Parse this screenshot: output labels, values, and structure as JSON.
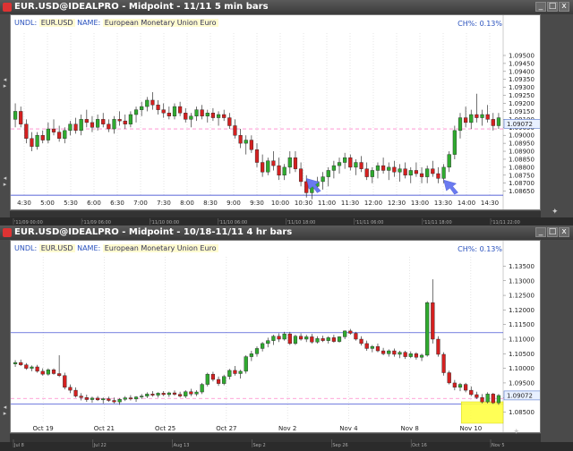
{
  "colors": {
    "bull": "#2faa2f",
    "bear": "#d42020",
    "grid": "#cccccc",
    "hline": "#2233cc",
    "pink": "#ff88cc",
    "highlight": "#ffff44",
    "arrow": "#6a7af0"
  },
  "panels": [
    {
      "title": "EUR.USD@IDEALPRO - Midpoint - 11/11 5 min bars",
      "info": {
        "prefix": "UNDL:",
        "symbol": "EUR.USD",
        "name_label": "NAME:",
        "name": "European Monetary Union Euro"
      },
      "change": "CH%: 0.13%",
      "price_label": "1.09072",
      "date_strip": [
        "'11/09 00:00",
        "'11/09 06:00",
        "'11/10 00:00",
        "'11/10 06:00",
        "'11/10 18:00",
        "'11/11 06:00",
        "'11/11 18:00",
        "'11/11 22:00"
      ],
      "buttons": {
        "min": "_",
        "max": "□",
        "close": "x"
      }
    },
    {
      "title": "EUR.USD@IDEALPRO - Midpoint - 10/18-11/11 4 hr bars",
      "info": {
        "prefix": "UNDL:",
        "symbol": "EUR.USD",
        "name_label": "NAME:",
        "name": "European Monetary Union Euro"
      },
      "change": "CH%: 0.13%",
      "price_label": "1.09072",
      "date_strip": [
        "Jul 8",
        "Jul 22",
        "Aug 13",
        "Sep 2",
        "Sep 26",
        "Oct 16",
        "Nov 5"
      ],
      "buttons": {
        "min": "_",
        "max": "□",
        "close": "x"
      }
    }
  ],
  "chart_data": [
    {
      "type": "candlestick",
      "title": "EUR.USD@IDEALPRO - Midpoint - 11/11 5 min bars",
      "x_ticks": [
        "4:30",
        "5:00",
        "5:30",
        "6:00",
        "6:30",
        "7:00",
        "7:30",
        "8:00",
        "8:30",
        "9:00",
        "9:30",
        "10:00",
        "10:30",
        "11:00",
        "11:30",
        "12:00",
        "12:30",
        "13:00",
        "13:30",
        "14:00",
        "14:30"
      ],
      "y_ticks": [
        1.0865,
        1.087,
        1.0875,
        1.088,
        1.0885,
        1.089,
        1.0895,
        1.09,
        1.0905,
        1.091,
        1.0915,
        1.092,
        1.0925,
        1.093,
        1.0935,
        1.094,
        1.0945,
        1.095
      ],
      "ylim": [
        1.0862,
        1.0964
      ],
      "reference_lines": [
        {
          "value": 1.08625,
          "style": "solid"
        },
        {
          "value": 1.0904,
          "style": "dashed"
        }
      ],
      "last_price": 1.09072,
      "candles": [
        [
          1.091,
          1.092,
          1.0905,
          1.0915
        ],
        [
          1.0915,
          1.0918,
          1.0905,
          1.0907
        ],
        [
          1.0907,
          1.091,
          1.0895,
          1.0898
        ],
        [
          1.0898,
          1.0902,
          1.089,
          1.0893
        ],
        [
          1.0893,
          1.0902,
          1.0891,
          1.09
        ],
        [
          1.09,
          1.0903,
          1.0895,
          1.0897
        ],
        [
          1.0897,
          1.0908,
          1.0895,
          1.0904
        ],
        [
          1.0904,
          1.091,
          1.09,
          1.0902
        ],
        [
          1.0902,
          1.0906,
          1.0896,
          1.0898
        ],
        [
          1.0898,
          1.0905,
          1.0895,
          1.0903
        ],
        [
          1.0903,
          1.0909,
          1.09,
          1.0907
        ],
        [
          1.0907,
          1.0911,
          1.0901,
          1.0903
        ],
        [
          1.0903,
          1.0913,
          1.09,
          1.091
        ],
        [
          1.091,
          1.0916,
          1.0905,
          1.0908
        ],
        [
          1.0908,
          1.0912,
          1.0902,
          1.0905
        ],
        [
          1.0905,
          1.0913,
          1.0903,
          1.091
        ],
        [
          1.091,
          1.0914,
          1.0905,
          1.0907
        ],
        [
          1.0907,
          1.091,
          1.0902,
          1.0904
        ],
        [
          1.0904,
          1.0912,
          1.0901,
          1.091
        ],
        [
          1.091,
          1.0915,
          1.0906,
          1.0909
        ],
        [
          1.0909,
          1.0913,
          1.0904,
          1.0907
        ],
        [
          1.0907,
          1.0915,
          1.0905,
          1.0913
        ],
        [
          1.0913,
          1.0918,
          1.0908,
          1.0916
        ],
        [
          1.0916,
          1.0921,
          1.0912,
          1.0918
        ],
        [
          1.0918,
          1.0924,
          1.0915,
          1.0922
        ],
        [
          1.0922,
          1.0927,
          1.0916,
          1.0919
        ],
        [
          1.0919,
          1.0922,
          1.0913,
          1.0916
        ],
        [
          1.0916,
          1.092,
          1.0911,
          1.0914
        ],
        [
          1.0914,
          1.0918,
          1.091,
          1.0912
        ],
        [
          1.0912,
          1.092,
          1.091,
          1.0918
        ],
        [
          1.0918,
          1.0921,
          1.0912,
          1.0914
        ],
        [
          1.0914,
          1.0917,
          1.0908,
          1.091
        ],
        [
          1.091,
          1.0914,
          1.0905,
          1.0912
        ],
        [
          1.0912,
          1.0918,
          1.0909,
          1.0916
        ],
        [
          1.0916,
          1.0919,
          1.091,
          1.0912
        ],
        [
          1.0912,
          1.0916,
          1.0908,
          1.0914
        ],
        [
          1.0914,
          1.0917,
          1.0909,
          1.0911
        ],
        [
          1.0911,
          1.0915,
          1.0906,
          1.0913
        ],
        [
          1.0913,
          1.0916,
          1.0909,
          1.0911
        ],
        [
          1.0911,
          1.0914,
          1.0904,
          1.0906
        ],
        [
          1.0906,
          1.091,
          1.0898,
          1.09
        ],
        [
          1.09,
          1.0904,
          1.0892,
          1.0895
        ],
        [
          1.0895,
          1.09,
          1.0888,
          1.0897
        ],
        [
          1.0897,
          1.09,
          1.0889,
          1.0891
        ],
        [
          1.0891,
          1.0895,
          1.088,
          1.0883
        ],
        [
          1.0883,
          1.0888,
          1.0874,
          1.0877
        ],
        [
          1.0877,
          1.0886,
          1.0875,
          1.0884
        ],
        [
          1.0884,
          1.089,
          1.0878,
          1.0881
        ],
        [
          1.0881,
          1.0886,
          1.0872,
          1.0875
        ],
        [
          1.0875,
          1.0882,
          1.0872,
          1.088
        ],
        [
          1.088,
          1.089,
          1.0876,
          1.0886
        ],
        [
          1.0886,
          1.089,
          1.0877,
          1.0879
        ],
        [
          1.0879,
          1.0883,
          1.0868,
          1.0871
        ],
        [
          1.0871,
          1.0875,
          1.0861,
          1.0864
        ],
        [
          1.0864,
          1.087,
          1.086,
          1.0868
        ],
        [
          1.0868,
          1.0874,
          1.0864,
          1.0871
        ],
        [
          1.0871,
          1.0877,
          1.0866,
          1.0874
        ],
        [
          1.0874,
          1.088,
          1.0868,
          1.0878
        ],
        [
          1.0878,
          1.0884,
          1.0873,
          1.0881
        ],
        [
          1.0881,
          1.0886,
          1.0876,
          1.0883
        ],
        [
          1.0883,
          1.0889,
          1.0879,
          1.0886
        ],
        [
          1.0886,
          1.0888,
          1.0878,
          1.088
        ],
        [
          1.088,
          1.0885,
          1.0875,
          1.0883
        ],
        [
          1.0883,
          1.0887,
          1.0877,
          1.0879
        ],
        [
          1.0879,
          1.0883,
          1.0872,
          1.0874
        ],
        [
          1.0874,
          1.088,
          1.087,
          1.0878
        ],
        [
          1.0878,
          1.0883,
          1.0873,
          1.0881
        ],
        [
          1.0881,
          1.0886,
          1.0876,
          1.0878
        ],
        [
          1.0878,
          1.0883,
          1.0872,
          1.088
        ],
        [
          1.088,
          1.0884,
          1.0874,
          1.0877
        ],
        [
          1.0877,
          1.0882,
          1.0871,
          1.0879
        ],
        [
          1.0879,
          1.0883,
          1.0873,
          1.0875
        ],
        [
          1.0875,
          1.088,
          1.087,
          1.0878
        ],
        [
          1.0878,
          1.0883,
          1.0874,
          1.0876
        ],
        [
          1.0876,
          1.088,
          1.087,
          1.0874
        ],
        [
          1.0874,
          1.0881,
          1.087,
          1.0879
        ],
        [
          1.0879,
          1.0884,
          1.0874,
          1.0876
        ],
        [
          1.0876,
          1.088,
          1.087,
          1.0873
        ],
        [
          1.0873,
          1.0882,
          1.087,
          1.088
        ],
        [
          1.088,
          1.089,
          1.0877,
          1.0888
        ],
        [
          1.0888,
          1.0906,
          1.0885,
          1.0903
        ],
        [
          1.0903,
          1.0914,
          1.0898,
          1.0911
        ],
        [
          1.0911,
          1.0918,
          1.0905,
          1.0908
        ],
        [
          1.0908,
          1.0916,
          1.0904,
          1.0913
        ],
        [
          1.0913,
          1.0926,
          1.0908,
          1.0911
        ],
        [
          1.0911,
          1.0916,
          1.0906,
          1.0913
        ],
        [
          1.0913,
          1.0919,
          1.0908,
          1.091
        ],
        [
          1.091,
          1.0914,
          1.0903,
          1.0906
        ],
        [
          1.0906,
          1.0914,
          1.0904,
          1.0911
        ]
      ],
      "annotations": [
        {
          "type": "arrow",
          "at_index": 53,
          "value": 1.0873
        },
        {
          "type": "arrow",
          "at_index": 78,
          "value": 1.0872
        }
      ]
    },
    {
      "type": "candlestick",
      "title": "EUR.USD@IDEALPRO - Midpoint - 10/18-11/11 4 hr bars",
      "x_ticks": [
        "Oct 19",
        "Oct 21",
        "Oct 25",
        "Oct 27",
        "Nov 2",
        "Nov 4",
        "Nov 8",
        "Nov 10"
      ],
      "y_ticks": [
        1.085,
        1.09,
        1.095,
        1.1,
        1.105,
        1.11,
        1.115,
        1.12,
        1.125,
        1.13,
        1.135
      ],
      "ylim": [
        1.0818,
        1.1382
      ],
      "reference_lines": [
        {
          "value": 1.1122,
          "style": "solid"
        },
        {
          "value": 1.0878,
          "style": "solid"
        },
        {
          "value": 1.0897,
          "style": "dashed"
        }
      ],
      "last_price": 1.09072,
      "candles": [
        [
          1.1015,
          1.1028,
          1.1005,
          1.102
        ],
        [
          1.102,
          1.103,
          1.1008,
          1.1012
        ],
        [
          1.1012,
          1.1018,
          1.0995,
          1.1
        ],
        [
          1.1,
          1.101,
          1.099,
          1.1005
        ],
        [
          1.1005,
          1.1012,
          1.0985,
          1.099
        ],
        [
          1.099,
          1.1,
          1.0975,
          1.098
        ],
        [
          1.098,
          1.1,
          1.0975,
          1.0995
        ],
        [
          1.0995,
          1.1,
          1.0978,
          1.0982
        ],
        [
          1.0982,
          1.1045,
          1.097,
          1.0975
        ],
        [
          1.0975,
          1.0985,
          1.0928,
          1.0935
        ],
        [
          1.0935,
          1.0945,
          1.0915,
          1.0925
        ],
        [
          1.0925,
          1.0935,
          1.09,
          1.0905
        ],
        [
          1.0905,
          1.0915,
          1.089,
          1.09
        ],
        [
          1.09,
          1.091,
          1.0885,
          1.0893
        ],
        [
          1.0893,
          1.0903,
          1.0882,
          1.0898
        ],
        [
          1.0898,
          1.0905,
          1.0888,
          1.0892
        ],
        [
          1.0892,
          1.09,
          1.088,
          1.0896
        ],
        [
          1.0896,
          1.0903,
          1.0885,
          1.089
        ],
        [
          1.089,
          1.09,
          1.088,
          1.0885
        ],
        [
          1.0885,
          1.0898,
          1.0875,
          1.0894
        ],
        [
          1.0894,
          1.0905,
          1.0888,
          1.0899
        ],
        [
          1.0899,
          1.0908,
          1.089,
          1.0895
        ],
        [
          1.0895,
          1.0905,
          1.0885,
          1.0902
        ],
        [
          1.0902,
          1.0912,
          1.0895,
          1.0905
        ],
        [
          1.0905,
          1.0918,
          1.0898,
          1.0912
        ],
        [
          1.0912,
          1.0922,
          1.0903,
          1.0908
        ],
        [
          1.0908,
          1.0918,
          1.09,
          1.0915
        ],
        [
          1.0915,
          1.0922,
          1.0905,
          1.091
        ],
        [
          1.091,
          1.092,
          1.0902,
          1.0916
        ],
        [
          1.0916,
          1.0924,
          1.0906,
          1.0911
        ],
        [
          1.0911,
          1.092,
          1.09,
          1.0905
        ],
        [
          1.0905,
          1.0925,
          1.0898,
          1.092
        ],
        [
          1.092,
          1.093,
          1.0905,
          1.0912
        ],
        [
          1.0912,
          1.0925,
          1.0905,
          1.0919
        ],
        [
          1.0919,
          1.095,
          1.0912,
          1.0945
        ],
        [
          1.0945,
          1.0985,
          1.0938,
          1.098
        ],
        [
          1.098,
          1.0988,
          1.0955,
          1.0962
        ],
        [
          1.0962,
          1.0972,
          1.094,
          1.0948
        ],
        [
          1.0948,
          1.0978,
          1.0942,
          1.0972
        ],
        [
          1.0972,
          1.0998,
          1.0962,
          1.0993
        ],
        [
          1.0993,
          1.1008,
          1.0975,
          1.0982
        ],
        [
          1.0982,
          1.0995,
          1.0965,
          1.099
        ],
        [
          1.099,
          1.1045,
          1.0982,
          1.104
        ],
        [
          1.104,
          1.106,
          1.1025,
          1.105
        ],
        [
          1.105,
          1.1075,
          1.104,
          1.1068
        ],
        [
          1.1068,
          1.109,
          1.1058,
          1.1085
        ],
        [
          1.1085,
          1.1105,
          1.1072,
          1.1095
        ],
        [
          1.1095,
          1.1115,
          1.108,
          1.111
        ],
        [
          1.111,
          1.112,
          1.109,
          1.11
        ],
        [
          1.11,
          1.1125,
          1.1095,
          1.1118
        ],
        [
          1.1118,
          1.1125,
          1.108,
          1.1085
        ],
        [
          1.1085,
          1.1115,
          1.108,
          1.111
        ],
        [
          1.111,
          1.112,
          1.1095,
          1.11
        ],
        [
          1.11,
          1.1115,
          1.109,
          1.1108
        ],
        [
          1.1108,
          1.1118,
          1.1085,
          1.109
        ],
        [
          1.109,
          1.111,
          1.1085,
          1.1102
        ],
        [
          1.1102,
          1.1112,
          1.109,
          1.1095
        ],
        [
          1.1095,
          1.111,
          1.1085,
          1.1105
        ],
        [
          1.1105,
          1.1115,
          1.1088,
          1.1092
        ],
        [
          1.1092,
          1.111,
          1.1088,
          1.1108
        ],
        [
          1.1108,
          1.113,
          1.11,
          1.1128
        ],
        [
          1.1128,
          1.1135,
          1.1115,
          1.112
        ],
        [
          1.112,
          1.1125,
          1.1095,
          1.11
        ],
        [
          1.11,
          1.111,
          1.1078,
          1.1085
        ],
        [
          1.1085,
          1.1095,
          1.106,
          1.1068
        ],
        [
          1.1068,
          1.108,
          1.1055,
          1.1075
        ],
        [
          1.1075,
          1.1085,
          1.1055,
          1.106
        ],
        [
          1.106,
          1.107,
          1.1045,
          1.105
        ],
        [
          1.105,
          1.1065,
          1.104,
          1.106
        ],
        [
          1.106,
          1.1068,
          1.104,
          1.1048
        ],
        [
          1.1048,
          1.106,
          1.1035,
          1.1055
        ],
        [
          1.1055,
          1.106,
          1.1032,
          1.104
        ],
        [
          1.104,
          1.1058,
          1.1035,
          1.105
        ],
        [
          1.105,
          1.1055,
          1.103,
          1.1038
        ],
        [
          1.1038,
          1.105,
          1.1025,
          1.1045
        ],
        [
          1.1045,
          1.123,
          1.104,
          1.1225
        ],
        [
          1.1225,
          1.1305,
          1.1085,
          1.11
        ],
        [
          1.11,
          1.111,
          1.104,
          1.1048
        ],
        [
          1.1048,
          1.1055,
          1.0975,
          1.0985
        ],
        [
          1.0985,
          1.0992,
          1.0945,
          1.095
        ],
        [
          1.095,
          1.096,
          1.0925,
          1.0935
        ],
        [
          1.0935,
          1.095,
          1.0922,
          1.0945
        ],
        [
          1.0945,
          1.095,
          1.0918,
          1.0925
        ],
        [
          1.0925,
          1.0938,
          1.0905,
          1.091
        ],
        [
          1.091,
          1.092,
          1.0895,
          1.09
        ],
        [
          1.09,
          1.0912,
          1.088,
          1.0885
        ],
        [
          1.0885,
          1.0918,
          1.088,
          1.0912
        ],
        [
          1.0912,
          1.0916,
          1.0878,
          1.0882
        ],
        [
          1.0882,
          1.0912,
          1.0875,
          1.0907
        ]
      ],
      "highlight": {
        "from_index": 82,
        "to_index": 86
      }
    }
  ]
}
